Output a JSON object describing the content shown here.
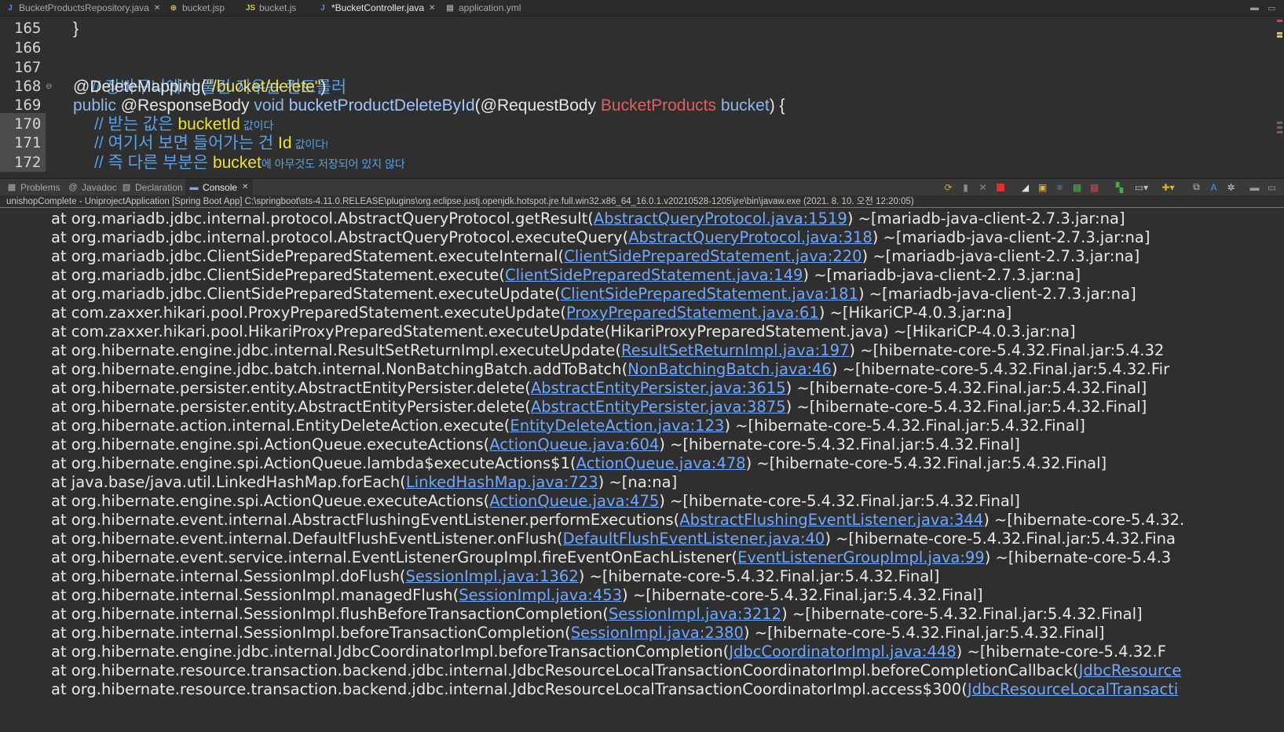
{
  "editor_tabs": [
    {
      "label": "BucketProductsRepository.java",
      "icon": "java-file-icon",
      "closable": true
    },
    {
      "label": "bucket.jsp",
      "icon": "web-page-icon",
      "closable": false
    },
    {
      "label": "bucket.js",
      "icon": "js-file-icon",
      "closable": false
    },
    {
      "label": "*BucketController.java",
      "icon": "java-file-icon",
      "closable": true
    },
    {
      "label": "application.yml",
      "icon": "yml-file-icon",
      "closable": false
    }
  ],
  "editor": {
    "active_tab": "*BucketController.java",
    "lines": [
      {
        "num": "165",
        "text": "}"
      },
      {
        "num": "166",
        "text": ""
      },
      {
        "num": "167",
        "text": "// 장바구니에서 물건 지우는 컨트롤러"
      },
      {
        "num": "168",
        "annotation": "@DeleteMapping(",
        "string": "\"/bucket/delete\"",
        "close": ")"
      },
      {
        "num": "169",
        "kw1": "public",
        "ann": "@ResponseBody",
        "kw2": "void",
        "method": "bucketProductDeleteById",
        "open": "(@RequestBody",
        "type": "BucketProducts",
        "param": "bucket",
        "close": ") {"
      },
      {
        "num": "170",
        "pre": "// 받는 값은 ",
        "var": "bucketId",
        "post": " 값이다"
      },
      {
        "num": "171",
        "pre": "// 여기서 보면 들어가는 건 ",
        "var": "Id",
        "post": " 값이다!"
      },
      {
        "num": "172",
        "pre": "// 즉 다른 부분은 ",
        "var": "bucket",
        "post": "에 아무것도 저장되어 있지 않다"
      }
    ]
  },
  "view_tabs": [
    {
      "label": "Problems",
      "icon": "problems-icon",
      "active": false
    },
    {
      "label": "Javadoc",
      "icon": "javadoc-icon",
      "active": false
    },
    {
      "label": "Declaration",
      "icon": "declaration-icon",
      "active": false
    },
    {
      "label": "Console",
      "icon": "console-icon",
      "active": true
    }
  ],
  "toolbar_icons": [
    "refresh-icon",
    "remove-launch-icon",
    "remove-all-icon",
    "terminate-icon",
    "clear-console-icon",
    "scroll-lock-icon",
    "word-wrap-icon",
    "show-on-stdout-icon",
    "show-on-stderr-icon",
    "pin-console-icon",
    "display-console-icon",
    "open-console-icon",
    "copy-icon",
    "text-format-icon",
    "settings-icon"
  ],
  "console": {
    "title": "unishopComplete - UniprojectApplication [Spring Boot App] C:\\springboot\\sts-4.11.0.RELEASE\\plugins\\org.eclipse.justj.openjdk.hotspot.jre.full.win32.x86_64_16.0.1.v20210528-1205\\jre\\bin\\javaw.exe  (2021. 8. 10. 오전 12:20:05)",
    "lines": [
      {
        "pre": "at org.mariadb.jdbc.internal.protocol.AbstractQueryProtocol.getResult(",
        "link": "AbstractQueryProtocol.java:1519",
        "post": ") ~[mariadb-java-client-2.7.3.jar:na]"
      },
      {
        "pre": "at org.mariadb.jdbc.internal.protocol.AbstractQueryProtocol.executeQuery(",
        "link": "AbstractQueryProtocol.java:318",
        "post": ") ~[mariadb-java-client-2.7.3.jar:na]"
      },
      {
        "pre": "at org.mariadb.jdbc.ClientSidePreparedStatement.executeInternal(",
        "link": "ClientSidePreparedStatement.java:220",
        "post": ") ~[mariadb-java-client-2.7.3.jar:na]"
      },
      {
        "pre": "at org.mariadb.jdbc.ClientSidePreparedStatement.execute(",
        "link": "ClientSidePreparedStatement.java:149",
        "post": ") ~[mariadb-java-client-2.7.3.jar:na]"
      },
      {
        "pre": "at org.mariadb.jdbc.ClientSidePreparedStatement.executeUpdate(",
        "link": "ClientSidePreparedStatement.java:181",
        "post": ") ~[mariadb-java-client-2.7.3.jar:na]"
      },
      {
        "pre": "at com.zaxxer.hikari.pool.ProxyPreparedStatement.executeUpdate(",
        "link": "ProxyPreparedStatement.java:61",
        "post": ") ~[HikariCP-4.0.3.jar:na]"
      },
      {
        "pre": "at com.zaxxer.hikari.pool.HikariProxyPreparedStatement.executeUpdate(HikariProxyPreparedStatement.java) ~[HikariCP-4.0.3.jar:na]",
        "link": "",
        "post": ""
      },
      {
        "pre": "at org.hibernate.engine.jdbc.internal.ResultSetReturnImpl.executeUpdate(",
        "link": "ResultSetReturnImpl.java:197",
        "post": ") ~[hibernate-core-5.4.32.Final.jar:5.4.32"
      },
      {
        "pre": "at org.hibernate.engine.jdbc.batch.internal.NonBatchingBatch.addToBatch(",
        "link": "NonBatchingBatch.java:46",
        "post": ") ~[hibernate-core-5.4.32.Final.jar:5.4.32.Fir"
      },
      {
        "pre": "at org.hibernate.persister.entity.AbstractEntityPersister.delete(",
        "link": "AbstractEntityPersister.java:3615",
        "post": ") ~[hibernate-core-5.4.32.Final.jar:5.4.32.Final]"
      },
      {
        "pre": "at org.hibernate.persister.entity.AbstractEntityPersister.delete(",
        "link": "AbstractEntityPersister.java:3875",
        "post": ") ~[hibernate-core-5.4.32.Final.jar:5.4.32.Final]"
      },
      {
        "pre": "at org.hibernate.action.internal.EntityDeleteAction.execute(",
        "link": "EntityDeleteAction.java:123",
        "post": ") ~[hibernate-core-5.4.32.Final.jar:5.4.32.Final]"
      },
      {
        "pre": "at org.hibernate.engine.spi.ActionQueue.executeActions(",
        "link": "ActionQueue.java:604",
        "post": ") ~[hibernate-core-5.4.32.Final.jar:5.4.32.Final]"
      },
      {
        "pre": "at org.hibernate.engine.spi.ActionQueue.lambda$executeActions$1(",
        "link": "ActionQueue.java:478",
        "post": ") ~[hibernate-core-5.4.32.Final.jar:5.4.32.Final]"
      },
      {
        "pre": "at java.base/java.util.LinkedHashMap.forEach(",
        "link": "LinkedHashMap.java:723",
        "post": ") ~[na:na]"
      },
      {
        "pre": "at org.hibernate.engine.spi.ActionQueue.executeActions(",
        "link": "ActionQueue.java:475",
        "post": ") ~[hibernate-core-5.4.32.Final.jar:5.4.32.Final]"
      },
      {
        "pre": "at org.hibernate.event.internal.AbstractFlushingEventListener.performExecutions(",
        "link": "AbstractFlushingEventListener.java:344",
        "post": ") ~[hibernate-core-5.4.32."
      },
      {
        "pre": "at org.hibernate.event.internal.DefaultFlushEventListener.onFlush(",
        "link": "DefaultFlushEventListener.java:40",
        "post": ") ~[hibernate-core-5.4.32.Final.jar:5.4.32.Fina"
      },
      {
        "pre": "at org.hibernate.event.service.internal.EventListenerGroupImpl.fireEventOnEachListener(",
        "link": "EventListenerGroupImpl.java:99",
        "post": ") ~[hibernate-core-5.4.3"
      },
      {
        "pre": "at org.hibernate.internal.SessionImpl.doFlush(",
        "link": "SessionImpl.java:1362",
        "post": ") ~[hibernate-core-5.4.32.Final.jar:5.4.32.Final]"
      },
      {
        "pre": "at org.hibernate.internal.SessionImpl.managedFlush(",
        "link": "SessionImpl.java:453",
        "post": ") ~[hibernate-core-5.4.32.Final.jar:5.4.32.Final]"
      },
      {
        "pre": "at org.hibernate.internal.SessionImpl.flushBeforeTransactionCompletion(",
        "link": "SessionImpl.java:3212",
        "post": ") ~[hibernate-core-5.4.32.Final.jar:5.4.32.Final]"
      },
      {
        "pre": "at org.hibernate.internal.SessionImpl.beforeTransactionCompletion(",
        "link": "SessionImpl.java:2380",
        "post": ") ~[hibernate-core-5.4.32.Final.jar:5.4.32.Final]"
      },
      {
        "pre": "at org.hibernate.engine.jdbc.internal.JdbcCoordinatorImpl.beforeTransactionCompletion(",
        "link": "JdbcCoordinatorImpl.java:448",
        "post": ") ~[hibernate-core-5.4.32.F"
      },
      {
        "pre": "at org.hibernate.resource.transaction.backend.jdbc.internal.JdbcResourceLocalTransactionCoordinatorImpl.beforeCompletionCallback(",
        "link": "JdbcResource",
        "post": ""
      },
      {
        "pre": "at org.hibernate.resource.transaction.backend.jdbc.internal.JdbcResourceLocalTransactionCoordinatorImpl.access$300(",
        "link": "JdbcResourceLocalTransacti",
        "post": ""
      }
    ]
  },
  "colors": {
    "background": "#2f2f2f",
    "link": "#6fa8ff",
    "comment": "#5aa0e6",
    "string": "#eedd66",
    "type": "#e06060",
    "terminate": "#e03030"
  }
}
